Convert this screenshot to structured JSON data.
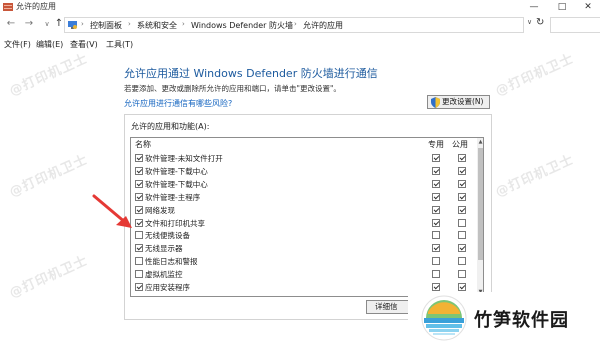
{
  "window": {
    "title": "允许的应用",
    "min": "—",
    "max": "□",
    "close": "✕"
  },
  "nav": {
    "back": "←",
    "forward": "→",
    "dropdown": "∨",
    "up": "↑",
    "refresh": "↻"
  },
  "breadcrumb": [
    "控制面板",
    "系统和安全",
    "Windows Defender 防火墙",
    "允许的应用"
  ],
  "menu": [
    "文件(F)",
    "编辑(E)",
    "查看(V)",
    "工具(T)"
  ],
  "watermark_text": "@打印机卫士",
  "page": {
    "heading": "允许应用通过 Windows Defender 防火墙进行通信",
    "subtitle": "若要添加、更改或删除所允许的应用和端口，请单击\"更改设置\"。",
    "risk_link": "允许应用进行通信有哪些风险?",
    "change_settings": "更改设置(N)",
    "group_label": "允许的应用和功能(A):",
    "columns": {
      "name": "名称",
      "private": "专用",
      "public": "公用"
    },
    "details_button": "详细信",
    "rows": [
      {
        "name": "软件管理-未知文件打开",
        "checked": true,
        "private": true,
        "public": true
      },
      {
        "name": "软件管理-下载中心",
        "checked": true,
        "private": true,
        "public": true
      },
      {
        "name": "软件管理-下载中心",
        "checked": true,
        "private": true,
        "public": true
      },
      {
        "name": "软件管理-主程序",
        "checked": true,
        "private": true,
        "public": true
      },
      {
        "name": "网络发现",
        "checked": true,
        "private": true,
        "public": true
      },
      {
        "name": "文件和打印机共享",
        "checked": true,
        "private": true,
        "public": false
      },
      {
        "name": "无线便携设备",
        "checked": false,
        "private": false,
        "public": false
      },
      {
        "name": "无线显示器",
        "checked": true,
        "private": true,
        "public": true
      },
      {
        "name": "性能日志和警报",
        "checked": false,
        "private": false,
        "public": false
      },
      {
        "name": "虚拟机监控",
        "checked": false,
        "private": false,
        "public": false
      },
      {
        "name": "应用安装程序",
        "checked": true,
        "private": true,
        "public": true
      }
    ]
  },
  "brand": {
    "name": "竹笋软件园"
  },
  "colors": {
    "heading": "#1c5a9e",
    "link": "#1565c0",
    "arrow": "#e53935"
  }
}
